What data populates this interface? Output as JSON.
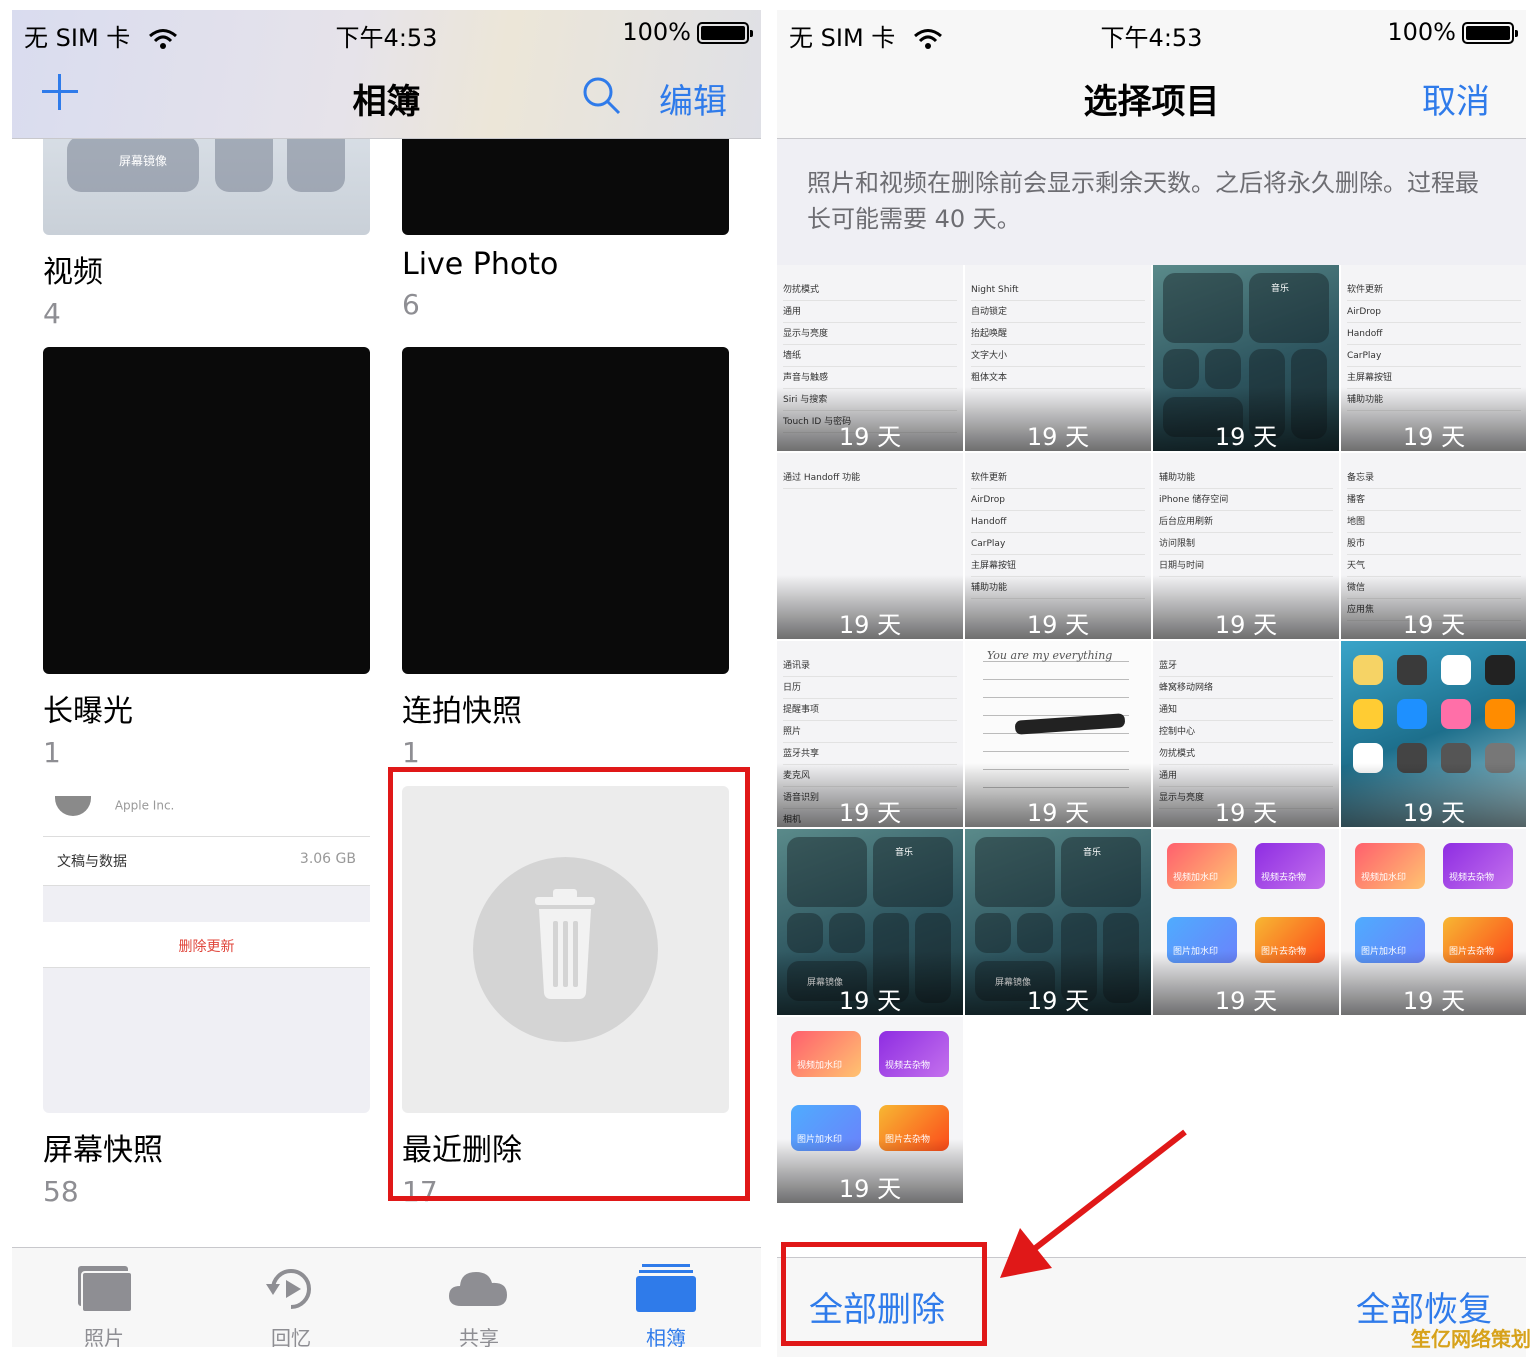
{
  "status": {
    "carrier": "无 SIM 卡",
    "time": "下午4:53",
    "battery": "100%"
  },
  "left": {
    "nav": {
      "title": "相簿",
      "add_icon": "plus-icon",
      "search_icon": "search-icon",
      "edit_label": "编辑"
    },
    "albums": [
      {
        "name": "视频",
        "count": "4"
      },
      {
        "name": "Live Photo",
        "count": "6"
      },
      {
        "name": "长曝光",
        "count": "1"
      },
      {
        "name": "连拍快照",
        "count": "1"
      },
      {
        "name": "屏幕快照",
        "count": "58"
      },
      {
        "name": "最近删除",
        "count": "17"
      }
    ],
    "video_thumb_label": "屏幕镜像",
    "screenshot_thumb": {
      "vendor": "Apple Inc.",
      "row_label": "文稿与数据",
      "row_value": "3.06 GB",
      "delete_label": "删除更新"
    },
    "tabs": [
      {
        "label": "照片",
        "icon": "photos-icon"
      },
      {
        "label": "回忆",
        "icon": "memories-icon"
      },
      {
        "label": "共享",
        "icon": "cloud-icon"
      },
      {
        "label": "相簿",
        "icon": "albums-icon"
      }
    ],
    "colors": {
      "accent": "#2f7bea",
      "highlight_box": "#e01818"
    }
  },
  "right": {
    "nav": {
      "title": "选择项目",
      "cancel_label": "取消"
    },
    "notice": "照片和视频在删除前会显示剩余天数。之后将永久删除。过程最长可能需要 40 天。",
    "items": [
      {
        "days": "19 天",
        "kind": "settings",
        "rows": [
          "勿扰模式",
          "通用",
          "显示与亮度",
          "墙纸",
          "声音与触感",
          "Siri 与搜索",
          "Touch ID 与密码"
        ]
      },
      {
        "days": "19 天",
        "kind": "settings",
        "rows": [
          "Night Shift",
          "自动锁定",
          "抬起唤醒",
          "文字大小",
          "粗体文本"
        ]
      },
      {
        "days": "19 天",
        "kind": "control",
        "rows": [
          "音乐"
        ]
      },
      {
        "days": "19 天",
        "kind": "settings",
        "rows": [
          "软件更新",
          "AirDrop",
          "Handoff",
          "CarPlay",
          "主屏幕按钮",
          "辅助功能"
        ]
      },
      {
        "days": "19 天",
        "kind": "settings",
        "rows": [
          "通过 Handoff 功能"
        ]
      },
      {
        "days": "19 天",
        "kind": "settings",
        "rows": [
          "软件更新",
          "AirDrop",
          "Handoff",
          "CarPlay",
          "主屏幕按钮",
          "辅助功能"
        ]
      },
      {
        "days": "19 天",
        "kind": "settings",
        "rows": [
          "辅助功能",
          "iPhone 储存空间",
          "后台应用刷新",
          "访问限制",
          "日期与时间"
        ]
      },
      {
        "days": "19 天",
        "kind": "settings",
        "rows": [
          "备忘录",
          "播客",
          "地图",
          "股市",
          "天气",
          "微信",
          "应用焦"
        ]
      },
      {
        "days": "19 天",
        "kind": "settings",
        "rows": [
          "通讯录",
          "日历",
          "提醒事项",
          "照片",
          "蓝牙共享",
          "麦克风",
          "语音识别",
          "相机"
        ]
      },
      {
        "days": "19 天",
        "kind": "note",
        "rows": [
          "You are my everything"
        ]
      },
      {
        "days": "19 天",
        "kind": "settings",
        "rows": [
          "蓝牙",
          "蜂窝移动网络",
          "通知",
          "控制中心",
          "勿扰模式",
          "通用",
          "显示与亮度"
        ]
      },
      {
        "days": "19 天",
        "kind": "home",
        "rows": []
      },
      {
        "days": "19 天",
        "kind": "control",
        "rows": [
          "音乐",
          "屏幕镜像"
        ]
      },
      {
        "days": "19 天",
        "kind": "control",
        "rows": [
          "音乐",
          "屏幕镜像"
        ]
      },
      {
        "days": "19 天",
        "kind": "shortcut",
        "rows": [
          "视频加水印",
          "视频去杂物",
          "图片加水印",
          "图片去杂物"
        ]
      },
      {
        "days": "19 天",
        "kind": "shortcut",
        "rows": [
          "视频加水印",
          "视频去杂物",
          "图片加水印",
          "图片去杂物"
        ]
      },
      {
        "days": "19 天",
        "kind": "shortcut",
        "rows": [
          "视频加水印",
          "视频去杂物",
          "图片加水印",
          "图片去杂物"
        ]
      }
    ],
    "bottom": {
      "delete_all_label": "全部删除",
      "restore_all_label": "全部恢复"
    }
  },
  "watermark": "笙亿网络策划"
}
